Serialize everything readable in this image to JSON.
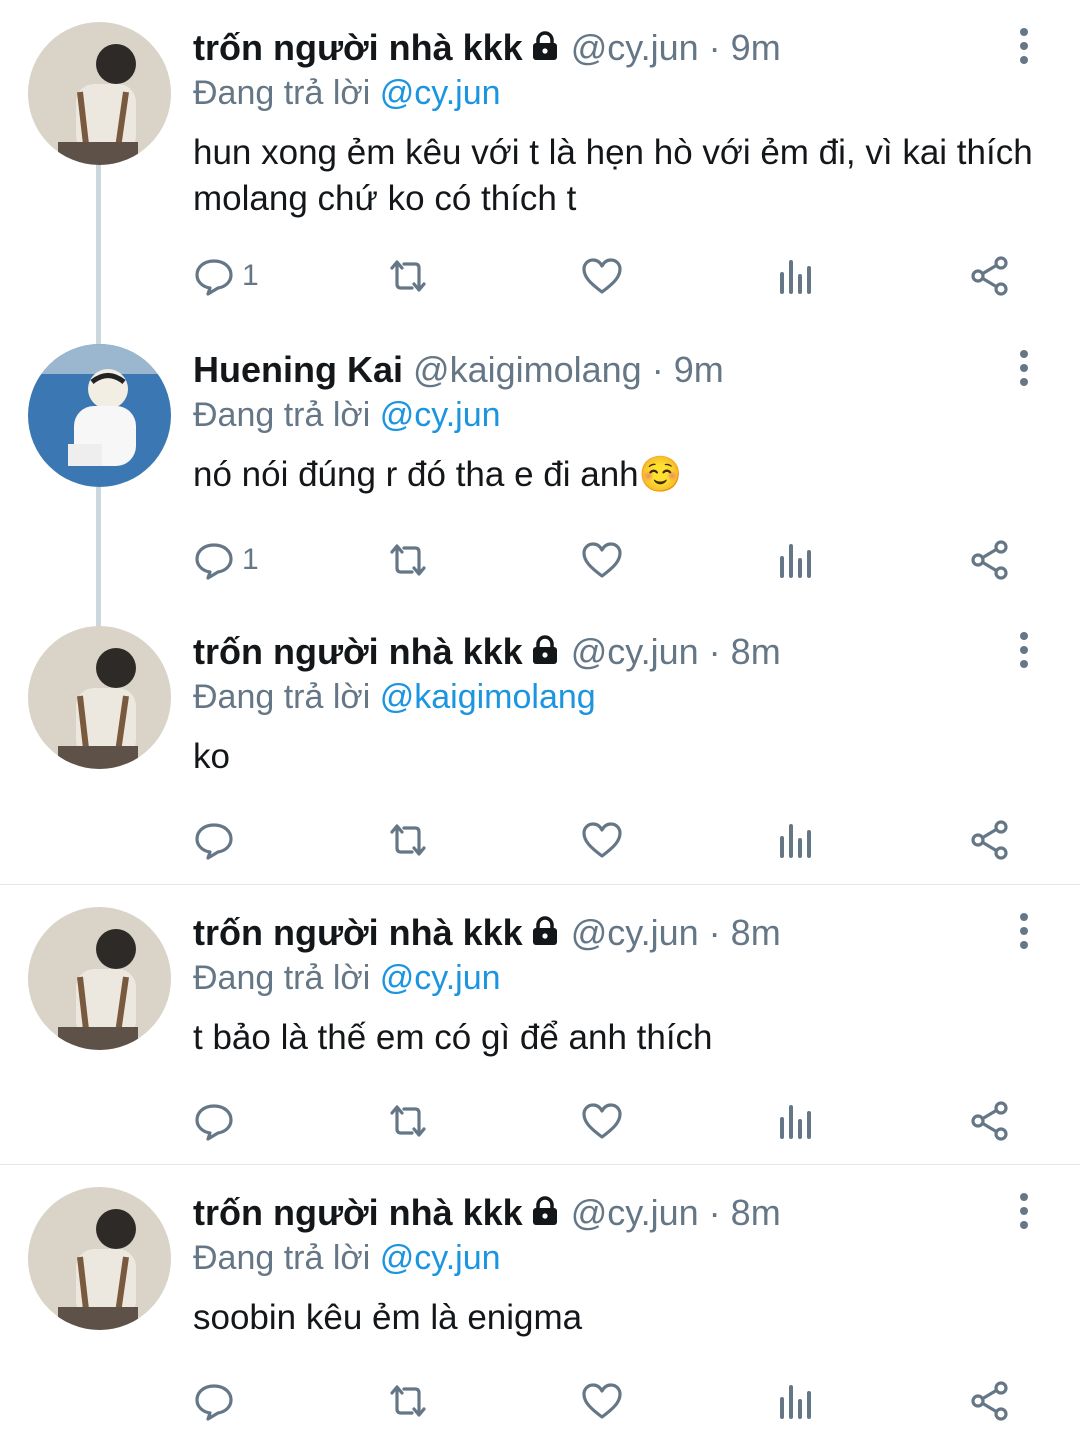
{
  "tweets": [
    {
      "name": "trốn người nhà kkk",
      "locked": true,
      "handle": "@cy.jun",
      "time": "9m",
      "reply_prefix": "Đang trả lời",
      "reply_to": "@cy.jun",
      "text": "hun xong ẻm kêu với t là hẹn hò với ẻm đi, vì kai thích molang chứ ko có thích t",
      "reply_count": "1",
      "avatar": "boy-photo-avatar"
    },
    {
      "name": "Huening Kai",
      "locked": false,
      "handle": "@kaigimolang",
      "time": "9m",
      "reply_prefix": "Đang trả lời",
      "reply_to": "@cy.jun",
      "text": "nó nói đúng r đó tha e đi anh☺️",
      "reply_count": "1",
      "avatar": "white-hoodie-avatar"
    },
    {
      "name": "trốn người nhà kkk",
      "locked": true,
      "handle": "@cy.jun",
      "time": "8m",
      "reply_prefix": "Đang trả lời",
      "reply_to": "@kaigimolang",
      "text": "ko",
      "reply_count": "",
      "avatar": "boy-photo-avatar"
    },
    {
      "name": "trốn người nhà kkk",
      "locked": true,
      "handle": "@cy.jun",
      "time": "8m",
      "reply_prefix": "Đang trả lời",
      "reply_to": "@cy.jun",
      "text": "t bảo là thế em có gì để anh thích",
      "reply_count": "",
      "avatar": "boy-photo-avatar"
    },
    {
      "name": "trốn người nhà kkk",
      "locked": true,
      "handle": "@cy.jun",
      "time": "8m",
      "reply_prefix": "Đang trả lời",
      "reply_to": "@cy.jun",
      "text": "soobin kêu ẻm là enigma",
      "reply_count": "",
      "avatar": "boy-photo-avatar"
    }
  ],
  "separator": "·",
  "colors": {
    "text": "#14171a",
    "secondary": "#657786",
    "link": "#1b95e0",
    "thread_line": "#ccd6dd",
    "divider": "#e1e8ed"
  },
  "icons": [
    "reply-icon",
    "retweet-icon",
    "like-icon",
    "stats-icon",
    "share-icon",
    "more-icon",
    "lock-icon"
  ]
}
